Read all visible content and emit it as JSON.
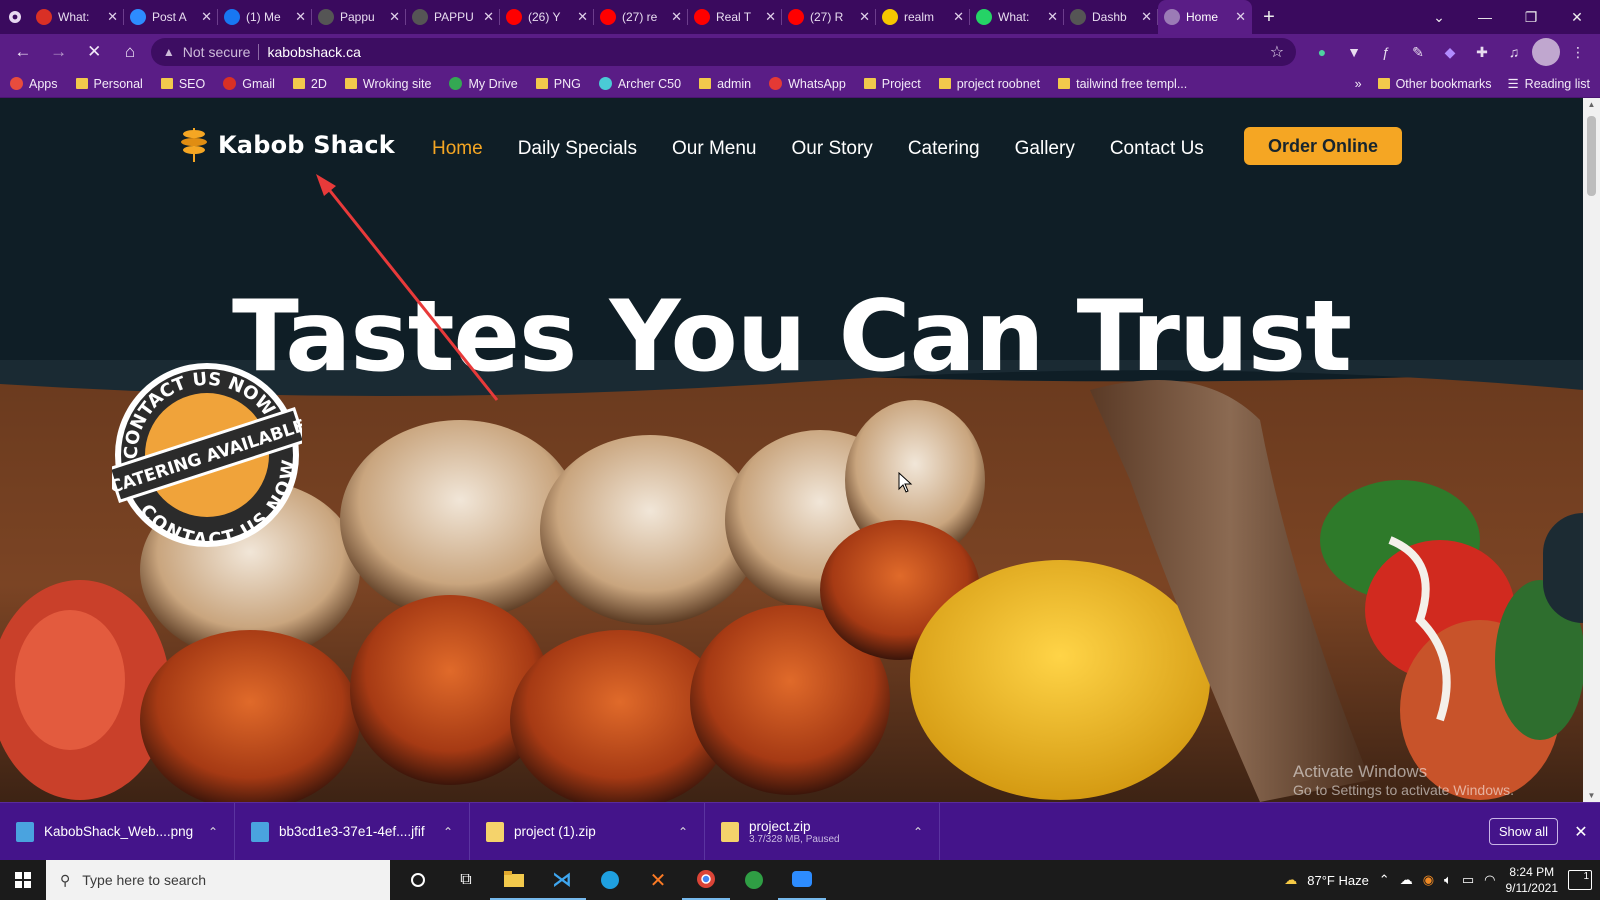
{
  "browser": {
    "tabs": [
      {
        "title": "What:",
        "favicon": "gmail-red",
        "color": "#d93025"
      },
      {
        "title": "Post A",
        "favicon": "zoom",
        "color": "#2d8cff"
      },
      {
        "title": "(1) Me",
        "favicon": "facebook",
        "color": "#1877f2"
      },
      {
        "title": "Pappu",
        "favicon": "globe",
        "color": "#555"
      },
      {
        "title": "PAPPU",
        "favicon": "globe",
        "color": "#555"
      },
      {
        "title": "(26) Y",
        "favicon": "youtube",
        "color": "#ff0000"
      },
      {
        "title": "(27) re",
        "favicon": "youtube",
        "color": "#ff0000"
      },
      {
        "title": "Real T",
        "favicon": "youtube",
        "color": "#ff0000"
      },
      {
        "title": "(27) R",
        "favicon": "youtube",
        "color": "#ff0000"
      },
      {
        "title": "realm",
        "favicon": "realme",
        "color": "#f7c600"
      },
      {
        "title": "What:",
        "favicon": "whatsapp",
        "color": "#25d366"
      },
      {
        "title": "Dashb",
        "favicon": "globe",
        "color": "#555"
      },
      {
        "title": "Home",
        "favicon": "loading",
        "color": "#9b7bb6",
        "active": true
      }
    ],
    "address": {
      "security_label": "Not secure",
      "url": "kabobshack.ca"
    },
    "bookmarks": [
      {
        "label": "Apps",
        "icon": "apps-grid-icon"
      },
      {
        "label": "Personal",
        "icon": "folder-icon"
      },
      {
        "label": "SEO",
        "icon": "folder-icon"
      },
      {
        "label": "Gmail",
        "icon": "gmail-icon"
      },
      {
        "label": "2D",
        "icon": "folder-icon"
      },
      {
        "label": "Wroking site",
        "icon": "folder-icon"
      },
      {
        "label": "My Drive",
        "icon": "drive-icon"
      },
      {
        "label": "PNG",
        "icon": "folder-icon"
      },
      {
        "label": "Archer C50",
        "icon": "tplink-icon"
      },
      {
        "label": "admin",
        "icon": "folder-icon"
      },
      {
        "label": "WhatsApp",
        "icon": "whatsapp-icon"
      },
      {
        "label": "Project",
        "icon": "folder-icon"
      },
      {
        "label": "project roobnet",
        "icon": "folder-icon"
      },
      {
        "label": "tailwind free templ...",
        "icon": "folder-icon"
      }
    ],
    "bookmarks_right": {
      "other": "Other bookmarks",
      "reading": "Reading list"
    }
  },
  "site": {
    "logo_text": "Kabob Shack",
    "nav": [
      {
        "label": "Home",
        "active": true
      },
      {
        "label": "Daily Specials"
      },
      {
        "label": "Our Menu"
      },
      {
        "label": "Our Story"
      },
      {
        "label": "Catering"
      },
      {
        "label": "Gallery"
      },
      {
        "label": "Contact Us"
      }
    ],
    "cta": "Order Online",
    "hero_title": "Tastes You Can Trust",
    "badge": {
      "top": "CONTACT US NOW",
      "middle": "CATERING AVAILABLE",
      "bottom": "CONTACT US NOW"
    },
    "accent": "#f5a623",
    "background": "#0f1e26"
  },
  "watermark": {
    "line1": "Activate Windows",
    "line2": "Go to Settings to activate Windows."
  },
  "downloads": {
    "items": [
      {
        "name": "KabobShack_Web....png",
        "type": "image"
      },
      {
        "name": "bb3cd1e3-37e1-4ef....jfif",
        "type": "image"
      },
      {
        "name": "project (1).zip",
        "type": "zip"
      },
      {
        "name": "project.zip",
        "status": "3.7/328 MB, Paused",
        "type": "zip"
      }
    ],
    "show_all": "Show all"
  },
  "taskbar": {
    "search_placeholder": "Type here to search",
    "weather": "87°F  Haze",
    "time": "8:24 PM",
    "date": "9/11/2021",
    "notifications": "1"
  }
}
